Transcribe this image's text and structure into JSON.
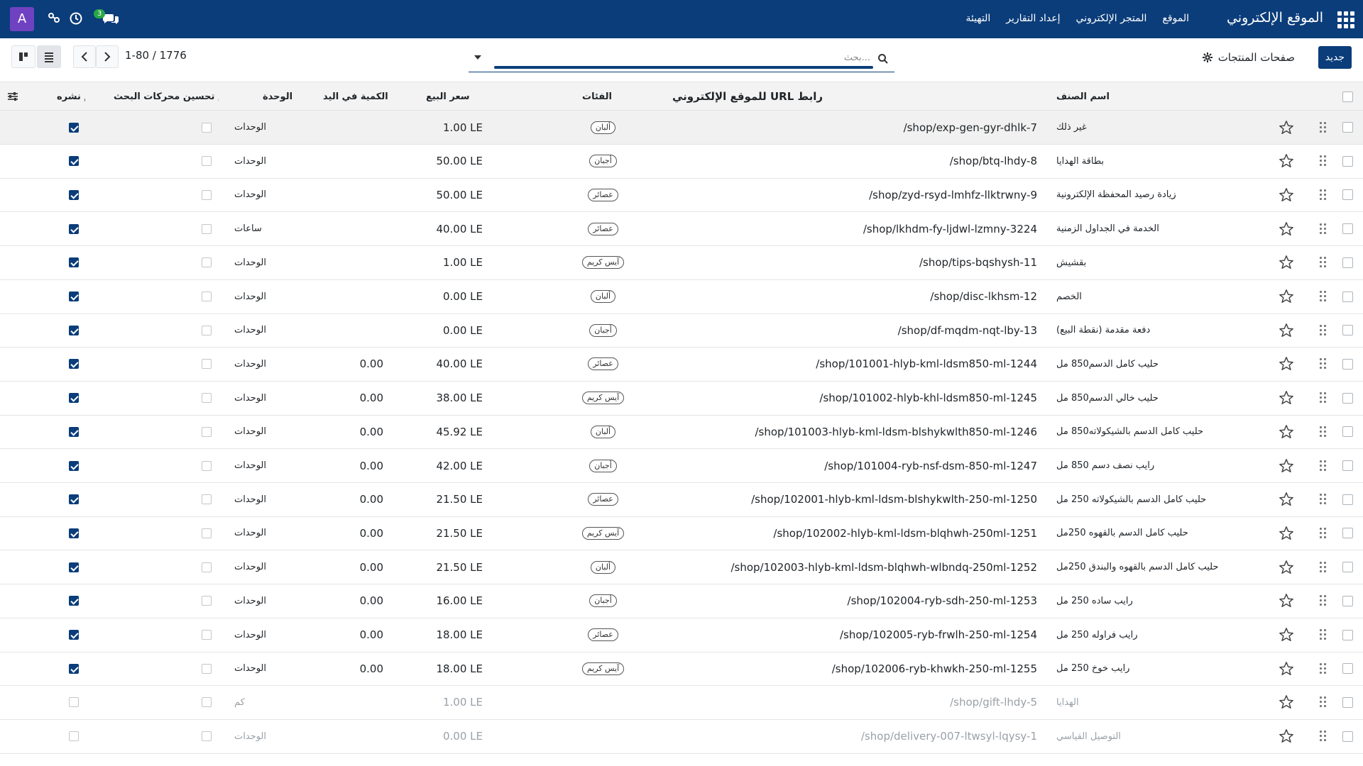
{
  "topbar": {
    "app_title": "الموقع الإلكتروني",
    "menu": [
      "الموقع",
      "المتجر الإلكتروني",
      "إعداد التقارير",
      "التهيئة"
    ],
    "avatar_letter": "A",
    "chat_badge": "3",
    "colors": {
      "bar": "#0b3d7a",
      "avatar": "#6f42c1",
      "badge": "#28a745"
    }
  },
  "control": {
    "new_button": "جديد",
    "breadcrumb": "صفحات المنتجات",
    "search_placeholder": "بحث...",
    "pager": "1-80 / 1776"
  },
  "columns": {
    "name": "اسم الصنف",
    "url": "رابط URL للموقع الإلكتروني",
    "categories": "الفئات",
    "price": "سعر البيع",
    "qty": "الكمية في اليد",
    "unit": "الوحدة",
    "seo": "تم تحسين محركات البحث",
    "published": "تم نشره"
  },
  "rows": [
    {
      "name": "غير ذلك",
      "url": "/shop/exp-gen-gyr-dhlk-7",
      "tag": "ألبان",
      "price": "1.00 LE",
      "qty": "",
      "unit": "الوحدات",
      "published": true
    },
    {
      "name": "بطاقة الهدايا",
      "url": "/shop/btq-lhdy-8",
      "tag": "أجبان",
      "price": "50.00 LE",
      "qty": "",
      "unit": "الوحدات",
      "published": true
    },
    {
      "name": "زيادة رصيد المحفظة الإلكترونية",
      "url": "/shop/zyd-rsyd-lmhfz-llktrwny-9",
      "tag": "عصائر",
      "price": "50.00 LE",
      "qty": "",
      "unit": "الوحدات",
      "published": true
    },
    {
      "name": "الخدمة في الجداول الزمنية",
      "url": "/shop/lkhdm-fy-ljdwl-lzmny-3224",
      "tag": "عصائر",
      "price": "40.00 LE",
      "qty": "",
      "unit": "ساعات",
      "published": true
    },
    {
      "name": "بقشيش",
      "url": "/shop/tips-bqshysh-11",
      "tag": "آيس كريم",
      "price": "1.00 LE",
      "qty": "",
      "unit": "الوحدات",
      "published": true
    },
    {
      "name": "الخصم",
      "url": "/shop/disc-lkhsm-12",
      "tag": "ألبان",
      "price": "0.00 LE",
      "qty": "",
      "unit": "الوحدات",
      "published": true
    },
    {
      "name": "دفعة مقدمة (نقطة البيع)",
      "url": "/shop/df-mqdm-nqt-lby-13",
      "tag": "أجبان",
      "price": "0.00 LE",
      "qty": "",
      "unit": "الوحدات",
      "published": true
    },
    {
      "name": "حليب كامل الدسم850 مل",
      "url": "/shop/101001-hlyb-kml-ldsm850-ml-1244",
      "tag": "عصائر",
      "price": "40.00 LE",
      "qty": "0.00",
      "unit": "الوحدات",
      "published": true
    },
    {
      "name": "حليب خالي الدسم850 مل",
      "url": "/shop/101002-hlyb-khl-ldsm850-ml-1245",
      "tag": "آيس كريم",
      "price": "38.00 LE",
      "qty": "0.00",
      "unit": "الوحدات",
      "published": true
    },
    {
      "name": "حليب كامل الدسم بالشيكولاته850 مل",
      "url": "/shop/101003-hlyb-kml-ldsm-blshykwlth850-ml-1246",
      "tag": "ألبان",
      "price": "45.92 LE",
      "qty": "0.00",
      "unit": "الوحدات",
      "published": true
    },
    {
      "name": "رايب نصف دسم 850 مل",
      "url": "/shop/101004-ryb-nsf-dsm-850-ml-1247",
      "tag": "أجبان",
      "price": "42.00 LE",
      "qty": "0.00",
      "unit": "الوحدات",
      "published": true
    },
    {
      "name": "حليب كامل الدسم بالشيكولاته 250 مل",
      "url": "/shop/102001-hlyb-kml-ldsm-blshykwlth-250-ml-1250",
      "tag": "عصائر",
      "price": "21.50 LE",
      "qty": "0.00",
      "unit": "الوحدات",
      "published": true
    },
    {
      "name": "حليب كامل الدسم بالقهوه 250مل",
      "url": "/shop/102002-hlyb-kml-ldsm-blqhwh-250ml-1251",
      "tag": "آيس كريم",
      "price": "21.50 LE",
      "qty": "0.00",
      "unit": "الوحدات",
      "published": true
    },
    {
      "name": "حليب كامل الدسم بالقهوه والبندق 250مل",
      "url": "/shop/102003-hlyb-kml-ldsm-blqhwh-wlbndq-250ml-1252",
      "tag": "ألبان",
      "price": "21.50 LE",
      "qty": "0.00",
      "unit": "الوحدات",
      "published": true
    },
    {
      "name": "رايب ساده 250 مل",
      "url": "/shop/102004-ryb-sdh-250-ml-1253",
      "tag": "أجبان",
      "price": "16.00 LE",
      "qty": "0.00",
      "unit": "الوحدات",
      "published": true
    },
    {
      "name": "رايب فراوله 250 مل",
      "url": "/shop/102005-ryb-frwlh-250-ml-1254",
      "tag": "عصائر",
      "price": "18.00 LE",
      "qty": "0.00",
      "unit": "الوحدات",
      "published": true
    },
    {
      "name": "رايب خوخ 250 مل",
      "url": "/shop/102006-ryb-khwkh-250-ml-1255",
      "tag": "آيس كريم",
      "price": "18.00 LE",
      "qty": "0.00",
      "unit": "الوحدات",
      "published": true
    },
    {
      "name": "الهدايا",
      "url": "/shop/gift-lhdy-5",
      "tag": "",
      "price": "1.00 LE",
      "qty": "",
      "unit": "كم",
      "published": false
    },
    {
      "name": "التوصيل القياسي",
      "url": "/shop/delivery-007-ltwsyl-lqysy-1",
      "tag": "",
      "price": "0.00 LE",
      "qty": "",
      "unit": "الوحدات",
      "published": false
    }
  ]
}
